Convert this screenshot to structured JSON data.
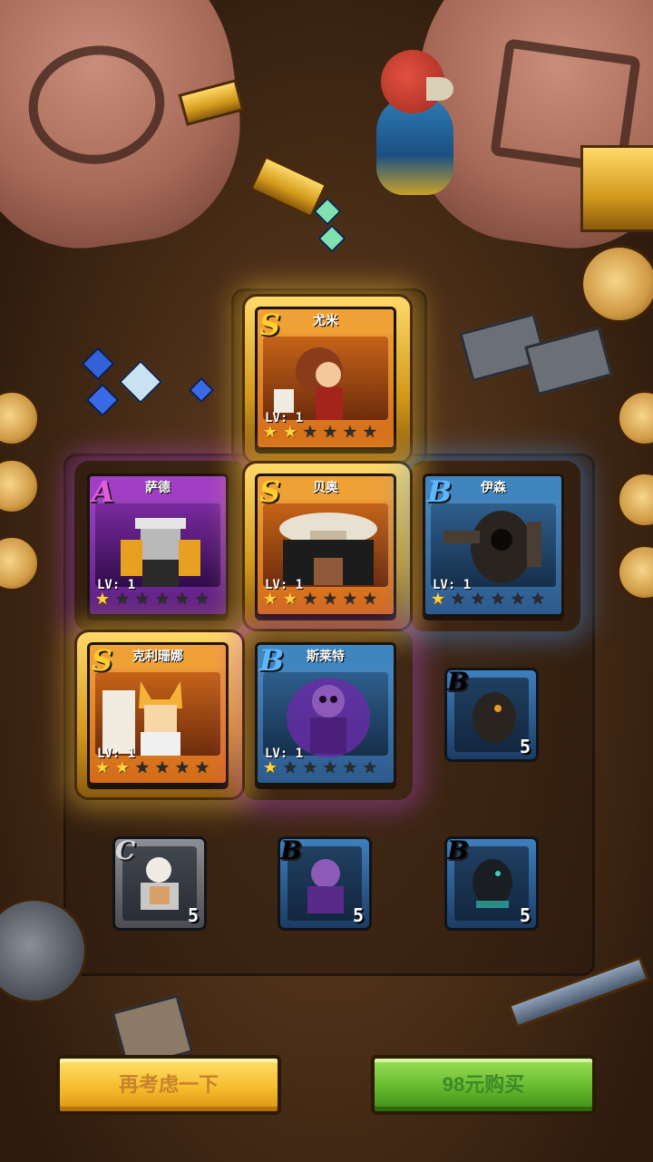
{
  "heroes": [
    {
      "name": "尤米",
      "grade": "S",
      "level": "LV: 1",
      "stars": 2
    },
    {
      "name": "萨德",
      "grade": "A",
      "level": "LV: 1",
      "stars": 1
    },
    {
      "name": "贝奥",
      "grade": "S",
      "level": "LV: 1",
      "stars": 2
    },
    {
      "name": "伊森",
      "grade": "B",
      "level": "LV: 1",
      "stars": 1
    },
    {
      "name": "克利珊娜",
      "grade": "S",
      "level": "LV: 1",
      "stars": 2
    },
    {
      "name": "斯莱特",
      "grade": "B",
      "level": "LV: 1",
      "stars": 1
    }
  ],
  "tokens": [
    {
      "grade": "B",
      "count": "5"
    },
    {
      "grade": "C",
      "count": "5"
    },
    {
      "grade": "B",
      "count": "5"
    },
    {
      "grade": "B",
      "count": "5"
    }
  ],
  "buttons": {
    "reconsider": "再考虑一下",
    "buy": "98元购买"
  },
  "colors": {
    "grade_S": "#f0a136",
    "grade_A": "#a03fc4",
    "grade_B": "#3f86c0",
    "grade_C": "#8d8f95",
    "button_yellow": "#f4b92a",
    "button_green": "#62b52a"
  }
}
